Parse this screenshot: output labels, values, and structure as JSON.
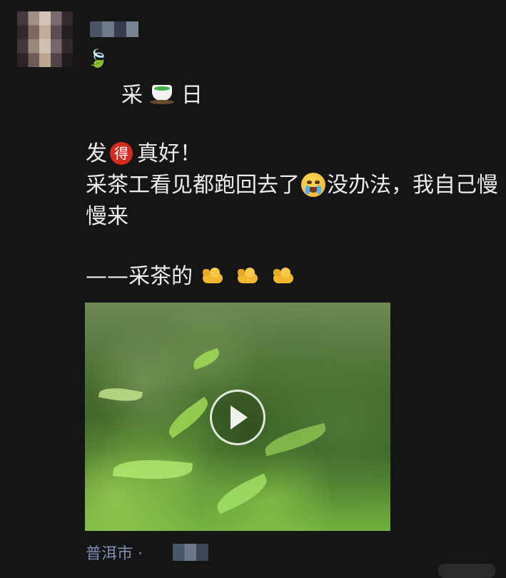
{
  "post": {
    "line_title_left": "采",
    "line_title_right": "日",
    "line1_a": "发",
    "badge_text": "得",
    "line1_b": "真好！",
    "line2_a": "采茶工看见都跑回去了",
    "line2_b": "没办法，我自己慢慢来",
    "line4_a": "——采茶的"
  },
  "location": {
    "text": "普洱市 ·"
  },
  "icons": {
    "leaf": "🍃",
    "tea": "teacup-icon",
    "crying_face": "crying-face-icon",
    "sad_face": "tear-face-icon",
    "muscle": "flexed-biceps-icon"
  }
}
